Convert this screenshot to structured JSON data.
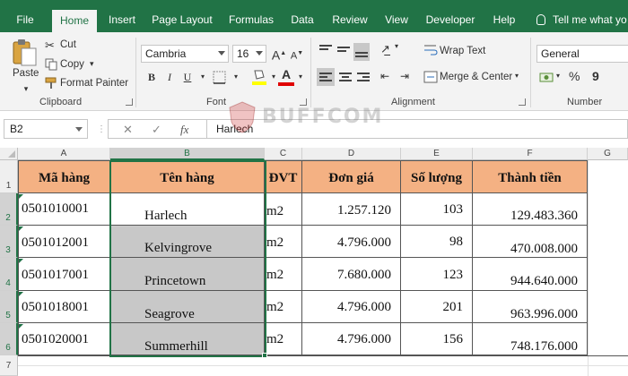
{
  "tabs": [
    {
      "label": "File"
    },
    {
      "label": "Home"
    },
    {
      "label": "Insert"
    },
    {
      "label": "Page Layout"
    },
    {
      "label": "Formulas"
    },
    {
      "label": "Data"
    },
    {
      "label": "Review"
    },
    {
      "label": "View"
    },
    {
      "label": "Developer"
    },
    {
      "label": "Help"
    }
  ],
  "tell_me": "Tell me what yo",
  "clipboard": {
    "paste": "Paste",
    "cut": "Cut",
    "copy": "Copy",
    "format_painter": "Format Painter",
    "label": "Clipboard"
  },
  "font": {
    "name": "Cambria",
    "size": "16",
    "bold": "B",
    "italic": "I",
    "underline": "U",
    "grow": "A",
    "shrink": "A",
    "color_letter": "A",
    "label": "Font"
  },
  "alignment": {
    "wrap_text": "Wrap Text",
    "merge_center": "Merge & Center",
    "label": "Alignment"
  },
  "number": {
    "format": "General",
    "percent": "%",
    "comma": "9",
    "label": "Number"
  },
  "formula_bar": {
    "name_box": "B2",
    "fx": "fx",
    "cancel": "✕",
    "enter": "✓",
    "content": "Harlech"
  },
  "columns": [
    "A",
    "B",
    "C",
    "D",
    "E",
    "F",
    "G"
  ],
  "rows": [
    "1",
    "2",
    "3",
    "4",
    "5",
    "6",
    "7"
  ],
  "table": {
    "headers": [
      "Mã hàng",
      "Tên hàng",
      "ĐVT",
      "Đơn giá",
      "Số lượng",
      "Thành tiền"
    ],
    "rows": [
      [
        "0501010001",
        "Harlech",
        "m2",
        "1.257.120",
        "103",
        "129.483.360"
      ],
      [
        "0501012001",
        "Kelvingrove",
        "m2",
        "4.796.000",
        "98",
        "470.008.000"
      ],
      [
        "0501017001",
        "Princetown",
        "m2",
        "7.680.000",
        "123",
        "944.640.000"
      ],
      [
        "0501018001",
        "Seagrove",
        "m2",
        "4.796.000",
        "201",
        "963.996.000"
      ],
      [
        "0501020001",
        "Summerhill",
        "m2",
        "4.796.000",
        "156",
        "748.176.000"
      ]
    ]
  },
  "watermark": "BUFFCOM",
  "colors": {
    "excel_green": "#217346",
    "header_fill": "#f4b183",
    "selected_fill": "#c8c8c8"
  }
}
